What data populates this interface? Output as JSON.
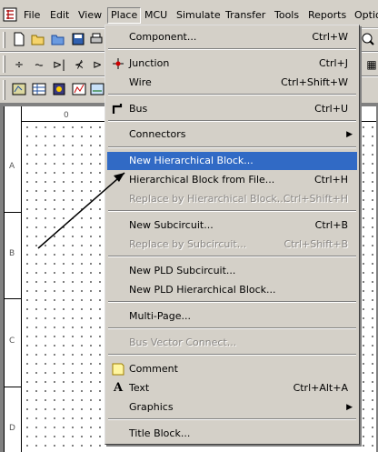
{
  "menubar": {
    "items": [
      {
        "label": "File"
      },
      {
        "label": "Edit"
      },
      {
        "label": "View"
      },
      {
        "label": "Place"
      },
      {
        "label": "MCU"
      },
      {
        "label": "Simulate"
      },
      {
        "label": "Transfer"
      },
      {
        "label": "Tools"
      },
      {
        "label": "Reports"
      },
      {
        "label": "Optio"
      }
    ]
  },
  "sheet": {
    "col_label": "0",
    "row_labels": [
      "A",
      "B",
      "C",
      "D"
    ]
  },
  "place_menu": {
    "items": [
      {
        "label": "Component...",
        "shortcut": "Ctrl+W"
      },
      {
        "label": "Junction",
        "shortcut": "Ctrl+J"
      },
      {
        "label": "Wire",
        "shortcut": "Ctrl+Shift+W"
      },
      {
        "label": "Bus",
        "shortcut": "Ctrl+U"
      },
      {
        "label": "Connectors",
        "shortcut": ""
      },
      {
        "label": "New Hierarchical Block...",
        "shortcut": ""
      },
      {
        "label": "Hierarchical Block from File...",
        "shortcut": "Ctrl+H"
      },
      {
        "label": "Replace by Hierarchical Block...",
        "shortcut": "Ctrl+Shift+H"
      },
      {
        "label": "New Subcircuit...",
        "shortcut": "Ctrl+B"
      },
      {
        "label": "Replace by Subcircuit...",
        "shortcut": "Ctrl+Shift+B"
      },
      {
        "label": "New PLD Subcircuit...",
        "shortcut": ""
      },
      {
        "label": "New PLD Hierarchical Block...",
        "shortcut": ""
      },
      {
        "label": "Multi-Page...",
        "shortcut": ""
      },
      {
        "label": "Bus Vector Connect...",
        "shortcut": ""
      },
      {
        "label": "Comment",
        "shortcut": ""
      },
      {
        "label": "Text",
        "shortcut": "Ctrl+Alt+A"
      },
      {
        "label": "Graphics",
        "shortcut": ""
      },
      {
        "label": "Title Block...",
        "shortcut": ""
      }
    ]
  },
  "colors": {
    "highlight": "#316ac5",
    "face": "#d4d0c8"
  }
}
